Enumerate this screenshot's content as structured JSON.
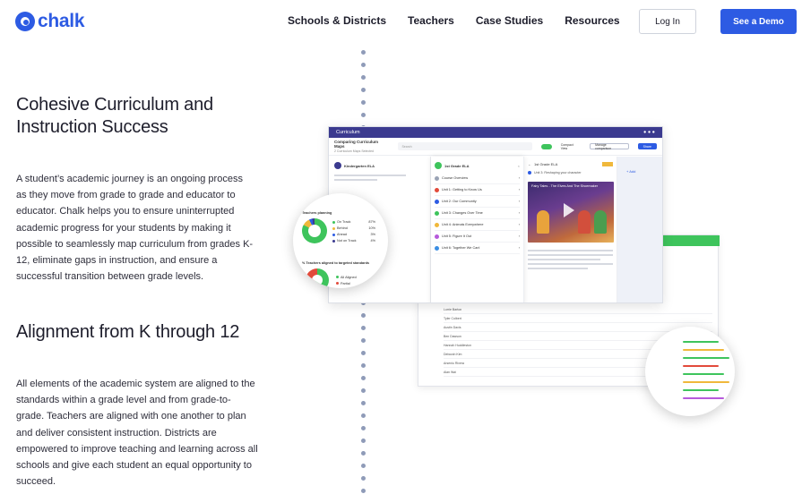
{
  "brand": {
    "logo_text": "chalk",
    "color": "#2d5be3"
  },
  "nav": {
    "items": [
      "Schools & Districts",
      "Teachers",
      "Case Studies",
      "Resources"
    ],
    "login_label": "Log In",
    "demo_label": "See a Demo"
  },
  "sections": [
    {
      "heading": "Cohesive Curriculum and Instruction Success",
      "body": "A student’s academic journey is an ongoing process as they move from grade to grade and educator to educator. Chalk helps you to ensure uninterrupted academic progress for your students by making it possible to seamlessly map curriculum from grades K-12, eliminate gaps in instruction, and ensure a successful transition between grade levels."
    },
    {
      "heading": "Alignment from K through 12",
      "body": "All elements of the academic system are aligned to the standards within a grade level and from grade-to-grade. Teachers are aligned with one another to plan and deliver consistent instruction. Districts are empowered to improve teaching and learning across all schools and give each student an equal opportunity to succeed."
    }
  ],
  "mock": {
    "app_title": "Curriculum",
    "subheader_title": "Comparing Curriculum Maps",
    "subheader_sub": "2 Curriculum Maps Selected",
    "search_placeholder": "Search",
    "compact_view": "Compact View",
    "manage_label": "Manage comparison",
    "share_label": "Share",
    "col1_title": "Kindergarten ELA",
    "col2_title": "1st Grade ELA",
    "col3_title": "1st Grade ELA",
    "col3_unit": "Unit 3: Reshaping your character",
    "units": [
      "Course Overview",
      "Unit 1: Getting to Know Us",
      "Unit 2: Our Community",
      "Unit 3: Changes Over Time",
      "Unit 4: Animals Everywhere",
      "Unit 5: Figure It Out",
      "Unit 6: Together We Can!"
    ],
    "unit_colors": [
      "#9aa3b5",
      "#e24a3b",
      "#2d5be3",
      "#3ec45c",
      "#f0b83b",
      "#b65adb",
      "#3b8ee3"
    ],
    "video_title": "Fairy Tales - The Elves And The Shoemaker",
    "add_label": "+ Add",
    "planning": {
      "title": "Teachers planning",
      "legend": [
        {
          "label": "On Track",
          "value": "87%",
          "color": "#3ec45c"
        },
        {
          "label": "Behind",
          "value": "10%",
          "color": "#f0b83b"
        },
        {
          "label": "Ahead",
          "value": "3%",
          "color": "#2d5be3"
        },
        {
          "label": "Not on Track",
          "value": "4%",
          "color": "#3b3a8f"
        }
      ],
      "aligned_title": "% Teachers aligned to targeted standards",
      "aligned_legend": [
        "All Aligned",
        "Partial"
      ]
    },
    "table_rows": [
      "Lorrie Barton",
      "Tyler Colbert",
      "Austin Davis",
      "Ben Dawson",
      "Hannah Huddleston",
      "Deborah Kim",
      "Arsenio Rivera",
      "Alan Wai"
    ]
  }
}
